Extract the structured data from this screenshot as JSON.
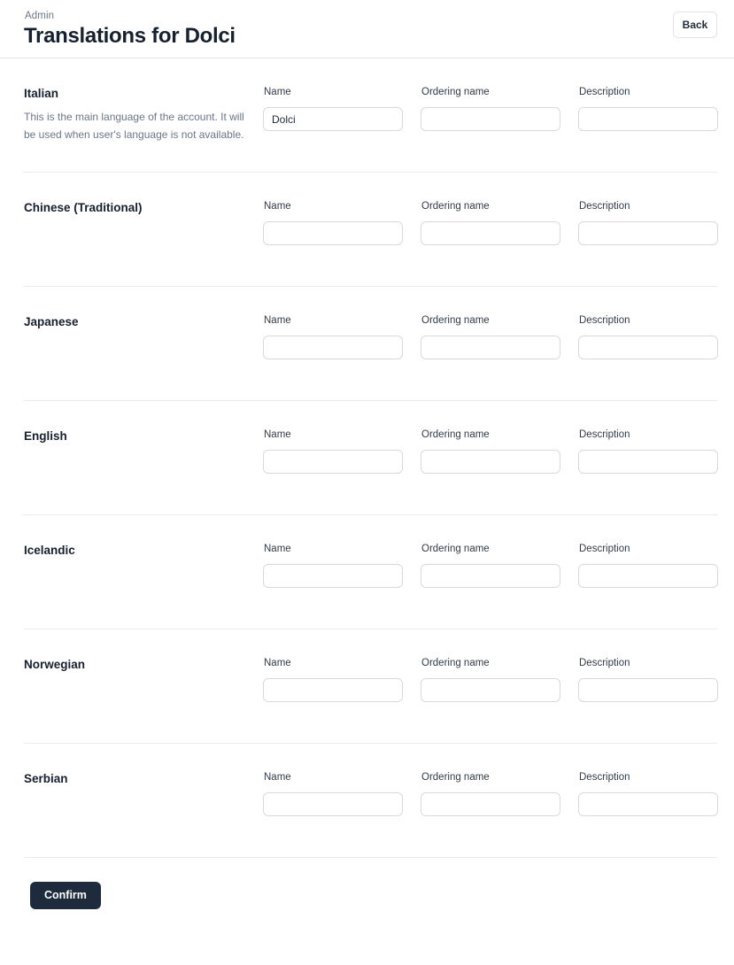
{
  "header": {
    "breadcrumb": "Admin",
    "title": "Translations for Dolci",
    "back_label": "Back"
  },
  "fields": {
    "name_label": "Name",
    "ordering_label": "Ordering name",
    "description_label": "Description"
  },
  "rows": [
    {
      "language": "Italian",
      "description": "This is the main language of the account. It will be used when user's language is not available.",
      "name_value": "Dolci",
      "ordering_value": "",
      "description_value": ""
    },
    {
      "language": "Chinese (Traditional)",
      "description": "",
      "name_value": "",
      "ordering_value": "",
      "description_value": ""
    },
    {
      "language": "Japanese",
      "description": "",
      "name_value": "",
      "ordering_value": "",
      "description_value": ""
    },
    {
      "language": "English",
      "description": "",
      "name_value": "",
      "ordering_value": "",
      "description_value": ""
    },
    {
      "language": "Icelandic",
      "description": "",
      "name_value": "",
      "ordering_value": "",
      "description_value": ""
    },
    {
      "language": "Norwegian",
      "description": "",
      "name_value": "",
      "ordering_value": "",
      "description_value": ""
    },
    {
      "language": "Serbian",
      "description": "",
      "name_value": "",
      "ordering_value": "",
      "description_value": ""
    }
  ],
  "footer": {
    "confirm_label": "Confirm"
  },
  "colors": {
    "accent": "#1e2b3d",
    "text": "#16202e",
    "muted": "#6b7687",
    "border": "#e8eaed",
    "input_border": "#d6dae0"
  }
}
